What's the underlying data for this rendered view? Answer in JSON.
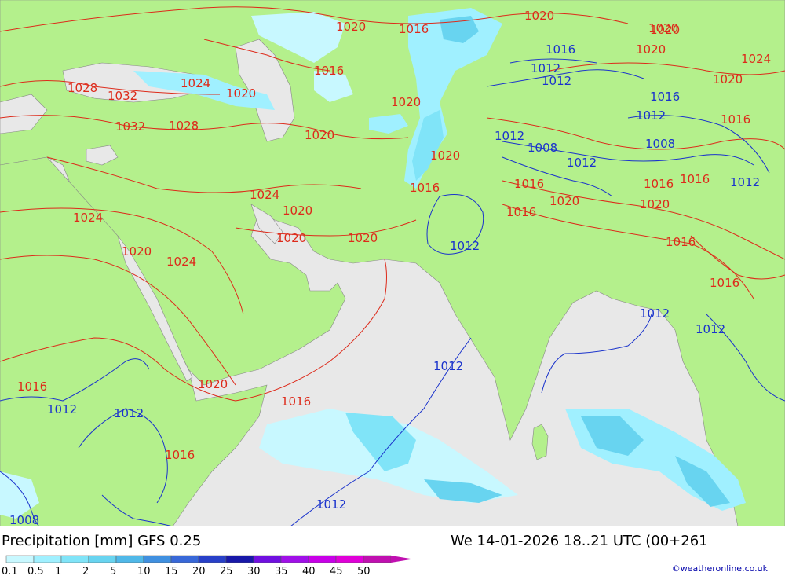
{
  "header": {
    "left_title": "Precipitation [mm] GFS 0.25",
    "right_title": "We 14-01-2026 18..21 UTC (00+261"
  },
  "legend": {
    "labels": [
      "0.1",
      "0.5",
      "1",
      "2",
      "5",
      "10",
      "15",
      "20",
      "25",
      "30",
      "35",
      "40",
      "45",
      "50"
    ],
    "colors": [
      "#c8f8ff",
      "#a0f0ff",
      "#80e4f8",
      "#68d4f0",
      "#50b8e8",
      "#4090e0",
      "#3868d8",
      "#2840c8",
      "#1818a8",
      "#7010e0",
      "#a010e8",
      "#c800e8",
      "#e000d8",
      "#c010b0"
    ]
  },
  "credit": "©weatheronline.co.uk",
  "isobar_labels": {
    "red": [
      "1020",
      "1016",
      "1020",
      "1020",
      "1024",
      "1016",
      "1028",
      "1032",
      "1024",
      "1020",
      "1032",
      "1028",
      "1020",
      "1020",
      "1020",
      "1020",
      "1016",
      "1024",
      "1020",
      "1024",
      "1020",
      "1020",
      "1020",
      "1016",
      "1016",
      "1020",
      "1016",
      "1016",
      "1020",
      "1016",
      "1016",
      "1016",
      "1024",
      "1020",
      "1016",
      "1020",
      "1016",
      "1020",
      "1016"
    ],
    "blue": [
      "1016",
      "1012",
      "1012",
      "1012",
      "1008",
      "1012",
      "1008",
      "1016",
      "1012",
      "1012",
      "1012",
      "1012",
      "1012",
      "1012",
      "1012",
      "1012",
      "1008",
      "1012"
    ]
  },
  "colors": {
    "land": "#b4f08c",
    "sea": "#e8e8e8",
    "red_isobar": "#dd2a1a",
    "blue_isobar": "#1a33cc"
  }
}
